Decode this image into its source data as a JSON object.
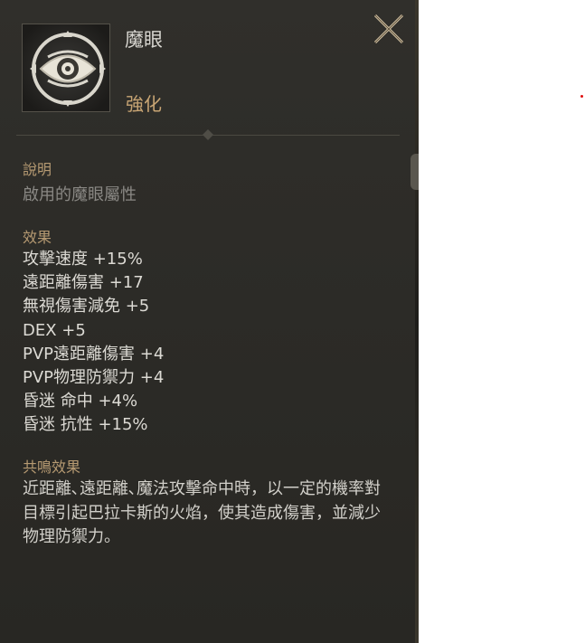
{
  "tooltip": {
    "item_name": "魔眼",
    "item_type": "強化",
    "icon": "eye-emblem-icon",
    "close_icon": "close-icon",
    "description": {
      "label": "說明",
      "text": "啟用的魔眼屬性"
    },
    "effects": {
      "label": "效果",
      "lines": [
        "攻擊速度 +15%",
        "遠距離傷害 +17",
        "無視傷害減免 +5",
        "DEX +5",
        "PVP遠距離傷害 +4",
        "PVP物理防禦力 +4",
        "昏迷 命中 +4%",
        "昏迷 抗性 +15%"
      ]
    },
    "resonance": {
      "label": "共鳴效果",
      "lines": [
        "近距離､遠距離､魔法攻擊命中時，以一定的機率對",
        "目標引起巴拉卡斯的火焰，使其造成傷害，並減少",
        "物理防禦力。"
      ]
    }
  },
  "colors": {
    "panel_bg": "#2d2c28",
    "label_gold": "#b69a72",
    "type_gold": "#c8a574",
    "text_light": "#dcdad4",
    "text_muted": "#8a8884"
  }
}
